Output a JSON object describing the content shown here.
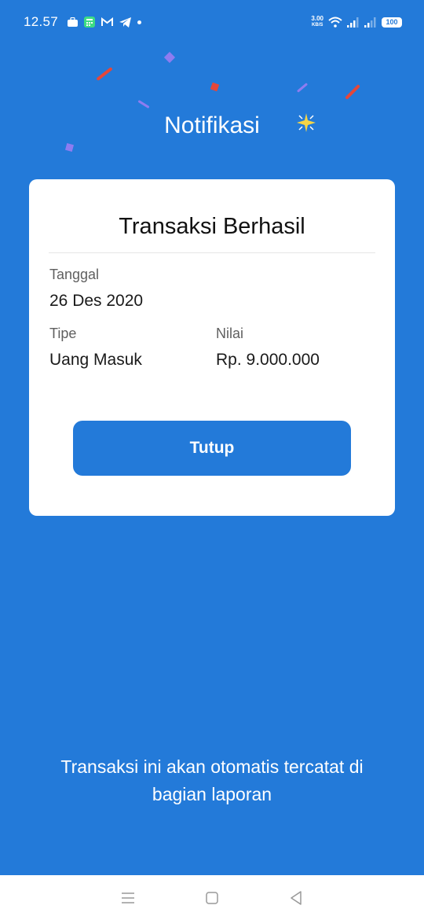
{
  "status_bar": {
    "time": "12.57",
    "net_speed_value": "3.00",
    "net_speed_unit": "KB/S",
    "battery": "100",
    "icons": [
      "briefcase-icon",
      "calculator-icon",
      "gmail-icon",
      "telegram-icon",
      "notification-dot-icon",
      "wifi-icon",
      "signal-icon",
      "signal-icon-2",
      "battery-icon"
    ]
  },
  "header": {
    "title": "Notifikasi"
  },
  "card": {
    "title": "Transaksi Berhasil",
    "date_label": "Tanggal",
    "date_value": "26 Des 2020",
    "type_label": "Tipe",
    "type_value": "Uang Masuk",
    "amount_label": "Nilai",
    "amount_value": "Rp. 9.000.000",
    "close_button": "Tutup"
  },
  "footer": {
    "note": "Transaksi ini akan otomatis tercatat di bagian laporan"
  },
  "nav_bar": {
    "icons": [
      "menu-icon",
      "home-square-icon",
      "back-triangle-icon"
    ]
  },
  "colors": {
    "background": "#237AD9",
    "card": "#FFFFFF",
    "button": "#237AD9",
    "confetti_red": "#E5473A",
    "confetti_purple": "#8E7CF0",
    "confetti_yellow": "#F5D547"
  }
}
